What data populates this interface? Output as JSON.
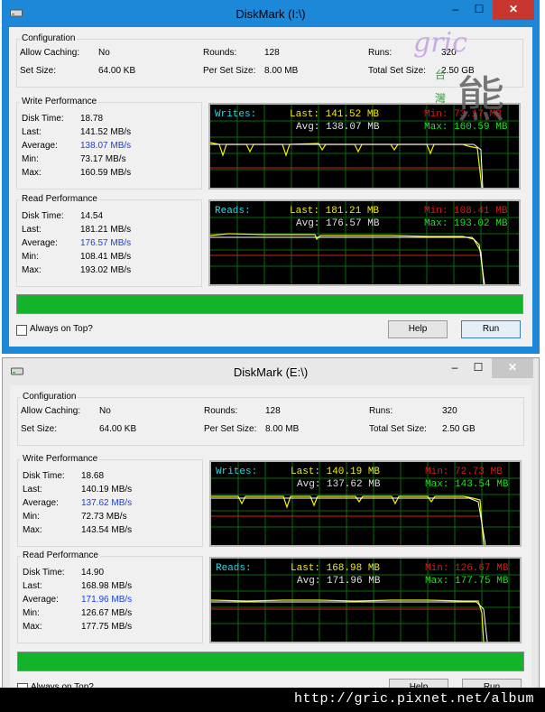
{
  "windows": [
    {
      "title": "DiskMark (I:\\)",
      "config": {
        "label": "Configuration",
        "allow_caching_label": "Allow Caching:",
        "allow_caching": "No",
        "set_size_label": "Set Size:",
        "set_size": "64.00 KB",
        "rounds_label": "Rounds:",
        "rounds": "128",
        "per_set_size_label": "Per Set Size:",
        "per_set_size": "8.00 MB",
        "runs_label": "Runs:",
        "runs": "320",
        "total_set_size_label": "Total Set Size:",
        "total_set_size": "2.50 GB"
      },
      "write": {
        "label": "Write Performance",
        "disk_time_label": "Disk Time:",
        "disk_time": "18.78",
        "last_label": "Last:",
        "last": "141.52 MB/s",
        "average_label": "Average:",
        "average": "138.07 MB/s",
        "min_label": "Min:",
        "min": "73.17 MB/s",
        "max_label": "Max:",
        "max": "160.59 MB/s",
        "graph": {
          "name": "Writes:",
          "last": "Last: 141.52 MB",
          "avg": "Avg: 138.07 MB",
          "min": "Min:  73.17 MB",
          "max": "Max: 160.59 MB"
        }
      },
      "read": {
        "label": "Read Performance",
        "disk_time_label": "Disk Time:",
        "disk_time": "14.54",
        "last_label": "Last:",
        "last": "181.21 MB/s",
        "average_label": "Average:",
        "average": "176.57 MB/s",
        "min_label": "Min:",
        "min": "108.41 MB/s",
        "max_label": "Max:",
        "max": "193.02 MB/s",
        "graph": {
          "name": "Reads:",
          "last": "Last: 181.21 MB",
          "avg": "Avg: 176.57 MB",
          "min": "Min: 108.41 MB",
          "max": "Max: 193.02 MB"
        }
      },
      "progress": 1.0,
      "always_on_top_label": "Always on Top?",
      "help_label": "Help",
      "run_label": "Run"
    },
    {
      "title": "DiskMark (E:\\)",
      "config": {
        "label": "Configuration",
        "allow_caching_label": "Allow Caching:",
        "allow_caching": "No",
        "set_size_label": "Set Size:",
        "set_size": "64.00 KB",
        "rounds_label": "Rounds:",
        "rounds": "128",
        "per_set_size_label": "Per Set Size:",
        "per_set_size": "8.00 MB",
        "runs_label": "Runs:",
        "runs": "320",
        "total_set_size_label": "Total Set Size:",
        "total_set_size": "2.50 GB"
      },
      "write": {
        "label": "Write Performance",
        "disk_time_label": "Disk Time:",
        "disk_time": "18.68",
        "last_label": "Last:",
        "last": "140.19 MB/s",
        "average_label": "Average:",
        "average": "137.62 MB/s",
        "min_label": "Min:",
        "min": "72.73 MB/s",
        "max_label": "Max:",
        "max": "143.54 MB/s",
        "graph": {
          "name": "Writes:",
          "last": "Last: 140.19 MB",
          "avg": "Avg: 137.62 MB",
          "min": "Min:  72.73 MB",
          "max": "Max: 143.54 MB"
        }
      },
      "read": {
        "label": "Read Performance",
        "disk_time_label": "Disk Time:",
        "disk_time": "14.90",
        "last_label": "Last:",
        "last": "168.98 MB/s",
        "average_label": "Average:",
        "average": "171.96 MB/s",
        "min_label": "Min:",
        "min": "126.67 MB/s",
        "max_label": "Max:",
        "max": "177.75 MB/s",
        "graph": {
          "name": "Reads:",
          "last": "Last: 168.98 MB",
          "avg": "Avg: 171.96 MB",
          "min": "Min: 126.67 MB",
          "max": "Max: 177.75 MB"
        }
      },
      "progress": 1.0,
      "always_on_top_label": "Always on Top?",
      "help_label": "Help",
      "run_label": "Run"
    }
  ],
  "watermark": {
    "text": "gric",
    "glyph": "熊",
    "small": [
      "台",
      "灣"
    ]
  },
  "footer": {
    "url": "http://gric.pixnet.net/album"
  },
  "colors": {
    "titlebar_active": "#1e88d8",
    "progress": "#12b42a",
    "close_active": "#c7372f",
    "average_text": "#1a3ee0"
  }
}
